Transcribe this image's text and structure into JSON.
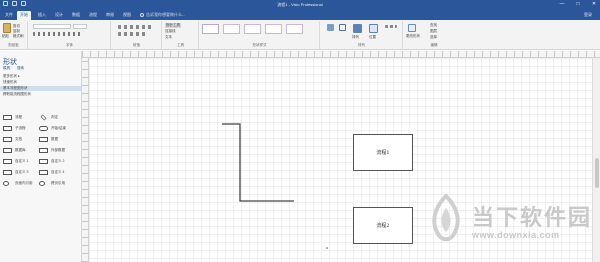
{
  "window": {
    "title": "流程1 - Visio Professional",
    "buttons": [
      "—",
      "□",
      "✕"
    ]
  },
  "tabs": [
    "文件",
    "开始",
    "插入",
    "设计",
    "数据",
    "流程",
    "审阅",
    "视图"
  ],
  "active_tab": "开始",
  "tell_me": "告诉我你想要做什么...",
  "account": "登录",
  "ribbon": {
    "groups": [
      "剪贴板",
      "字体",
      "段落",
      "工具",
      "形状样式",
      "排列",
      "编辑"
    ],
    "clipboard": {
      "paste": "粘贴",
      "cut": "剪切",
      "copy": "复制",
      "format_painter": "格式刷"
    },
    "tools": {
      "pointer": "指针工具",
      "connector": "连接线",
      "text": "文本"
    },
    "arrange": {
      "align": "排列",
      "position": "位置"
    },
    "editing": {
      "find": "查找",
      "layers": "图层",
      "select": "选择",
      "change_shape": "更改形状"
    }
  },
  "left_pane": {
    "title": "形状",
    "sub_tabs": [
      "模具",
      "搜索"
    ],
    "rows": [
      "更多形状 ▸",
      "快速形状",
      "基本流程图形状",
      "跨职能流程图形状"
    ],
    "selected_row": "基本流程图形状",
    "shapes": [
      [
        "流程",
        "判定"
      ],
      [
        "子流程",
        "开始/结束"
      ],
      [
        "文档",
        "数据"
      ],
      [
        "数据库",
        "外部数据"
      ],
      [
        "自定义 1",
        "自定义 2"
      ],
      [
        "自定义 3",
        "自定义 4"
      ],
      [
        "页面内引用",
        "跨页引用"
      ]
    ]
  },
  "canvas": {
    "process1": "流程1",
    "process2": "流程2"
  },
  "watermark": {
    "brand": "当下软件园",
    "url": "www.downxia.com"
  },
  "colors": {
    "accent": "#2b579a",
    "grid": "#e2e2e2",
    "watermark": "#c9c9c9"
  }
}
